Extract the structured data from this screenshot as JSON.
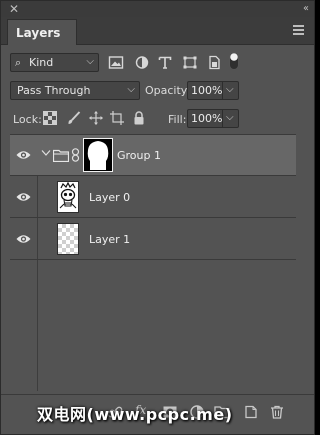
{
  "window": {
    "close_glyph": "✕",
    "collapse_glyph": "‹‹"
  },
  "tab": {
    "label": "Layers"
  },
  "filter": {
    "kind_label": "Kind",
    "icons": [
      "image-filter-icon",
      "adjustment-filter-icon",
      "type-filter-icon",
      "shape-filter-icon",
      "smart-object-filter-icon",
      "filter-toggle-icon"
    ]
  },
  "blend": {
    "mode": "Pass Through",
    "opacity_label": "Opacity:",
    "opacity_value": "100%"
  },
  "lock": {
    "label": "Lock:",
    "icons": [
      "lock-transparent-pixels-icon",
      "lock-image-pixels-icon",
      "lock-position-icon",
      "lock-artboard-icon",
      "lock-all-icon"
    ],
    "fill_label": "Fill:",
    "fill_value": "100%"
  },
  "layers": [
    {
      "name": "Group 1",
      "type": "group",
      "visible": true,
      "selected": true,
      "expanded": true
    },
    {
      "name": "Layer 0",
      "type": "pixel",
      "visible": true,
      "selected": false
    },
    {
      "name": "Layer 1",
      "type": "pixel",
      "visible": true,
      "selected": false
    }
  ],
  "toolbar": {
    "fx_label": "fx",
    "icons": [
      "link-layers-icon",
      "layer-style-icon",
      "add-mask-icon",
      "adjustment-layer-icon",
      "new-group-icon",
      "new-layer-icon",
      "delete-layer-icon"
    ]
  },
  "watermark": "双电网(www.pcpc.me)",
  "colors": {
    "panel_bg": "#535353",
    "selected_row": "#676767",
    "tab_bar": "#3c3c3c"
  }
}
